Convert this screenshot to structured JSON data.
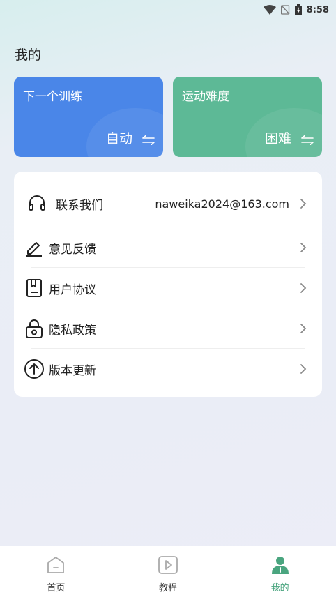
{
  "status_bar": {
    "time": "8:58"
  },
  "page_title": "我的",
  "cards": [
    {
      "title": "下一个训练",
      "value": "自动",
      "color": "#4a86e8"
    },
    {
      "title": "运动难度",
      "value": "困难",
      "color": "#5db996"
    }
  ],
  "menu": {
    "items": [
      {
        "label": "联系我们",
        "value": "naweika2024@163.com",
        "icon": "headset-icon"
      },
      {
        "label": "意见反馈",
        "icon": "edit-icon"
      },
      {
        "label": "用户协议",
        "icon": "document-icon"
      },
      {
        "label": "隐私政策",
        "icon": "lock-icon"
      },
      {
        "label": "版本更新",
        "icon": "arrow-up-circle-icon"
      }
    ]
  },
  "bottom_nav": {
    "items": [
      {
        "label": "首页",
        "icon": "home-icon"
      },
      {
        "label": "教程",
        "icon": "play-icon"
      },
      {
        "label": "我的",
        "icon": "profile-icon",
        "active": true
      }
    ],
    "active_color": "#4aa57f"
  }
}
